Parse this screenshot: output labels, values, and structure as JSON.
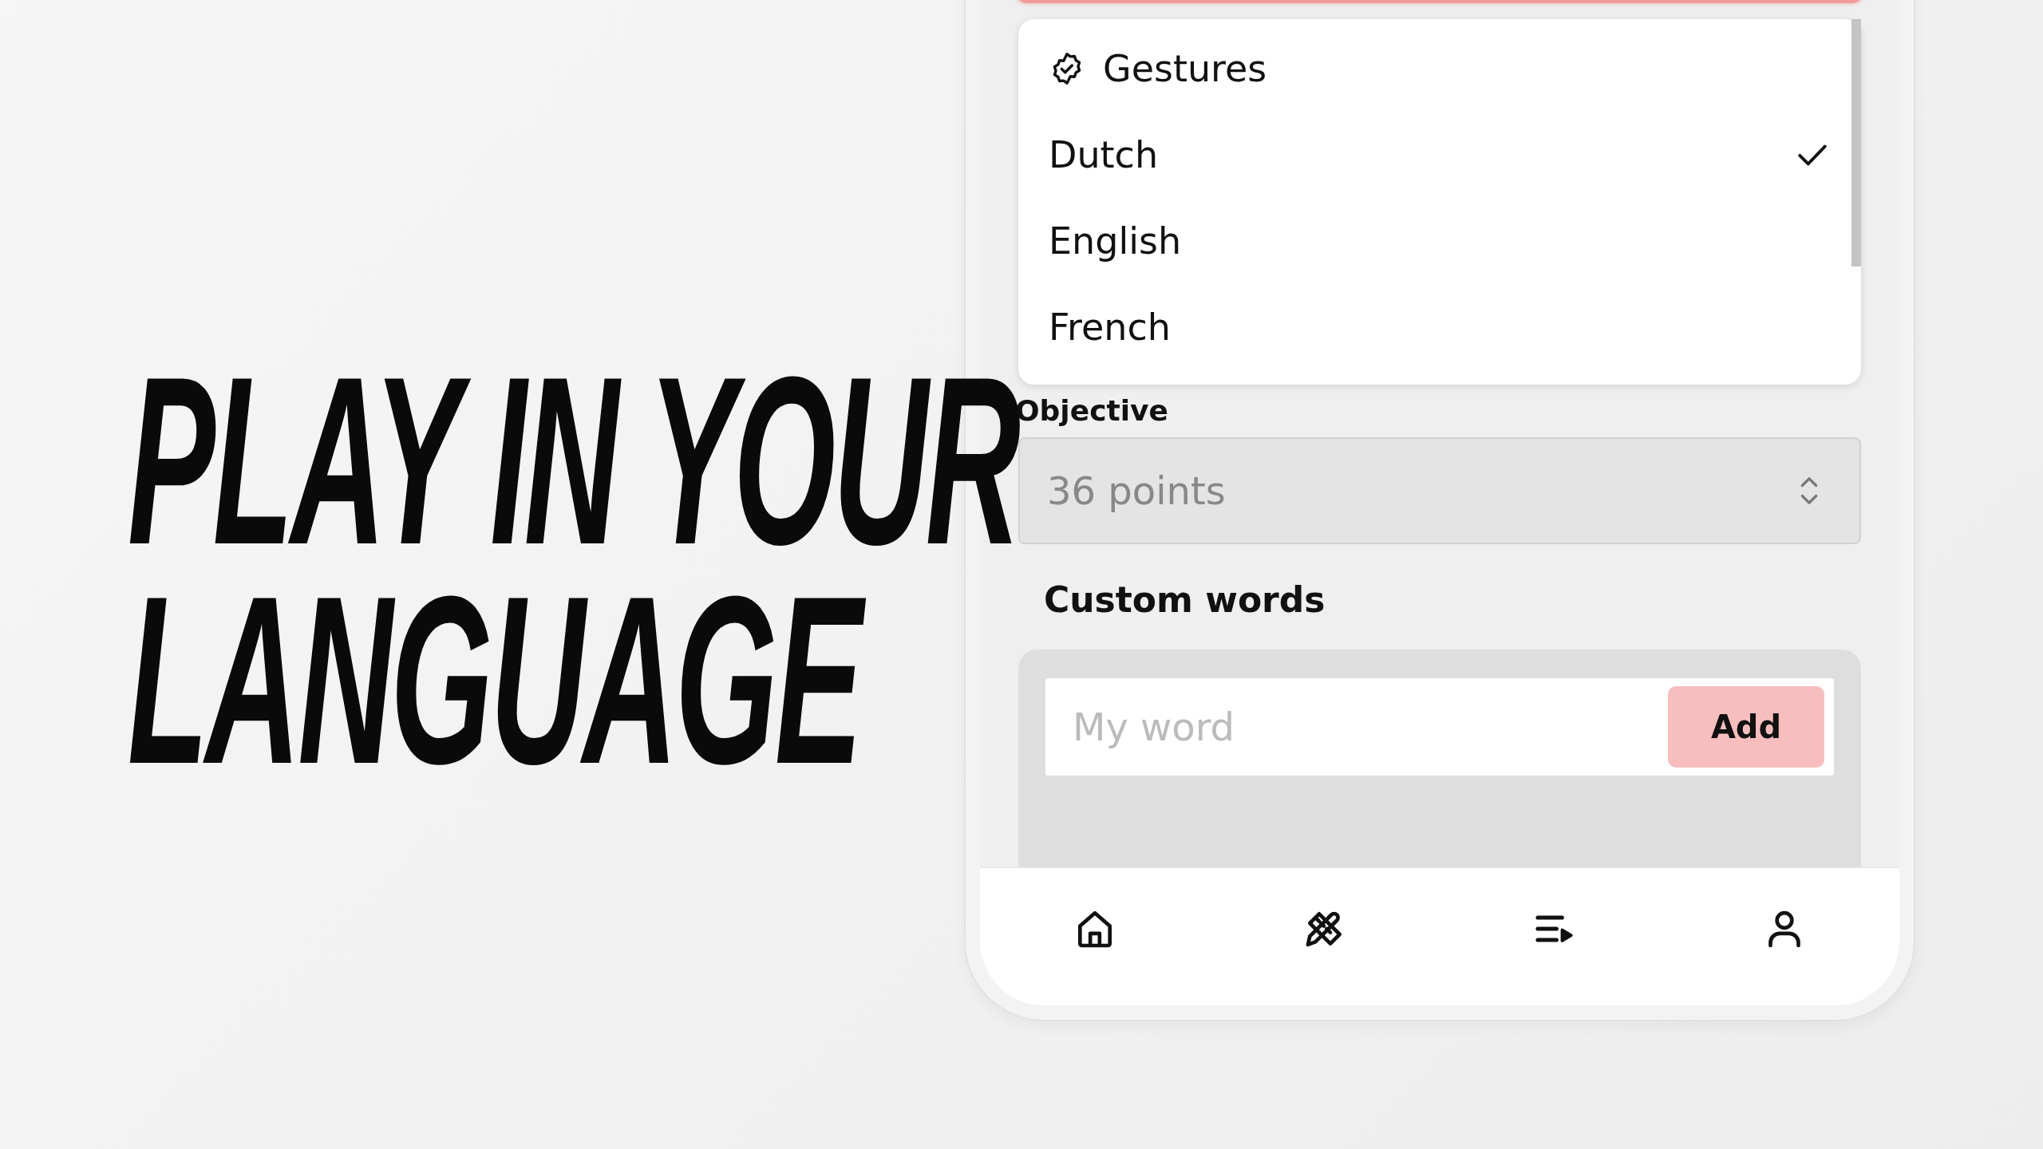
{
  "headline": {
    "lines": [
      "PLAY IN YOUR",
      "LANGUAGE"
    ]
  },
  "language_menu": {
    "header": {
      "label": "Gestures"
    },
    "options": [
      {
        "label": "Dutch",
        "selected": true
      },
      {
        "label": "English",
        "selected": false
      },
      {
        "label": "French",
        "selected": false
      }
    ]
  },
  "objective": {
    "label": "Objective",
    "value": "36 points"
  },
  "custom_words": {
    "title": "Custom words",
    "input": {
      "placeholder": "My word"
    },
    "add_button": "Add"
  },
  "nav": [
    {
      "kind": "home"
    },
    {
      "kind": "tools"
    },
    {
      "kind": "playlist"
    },
    {
      "kind": "profile"
    }
  ]
}
